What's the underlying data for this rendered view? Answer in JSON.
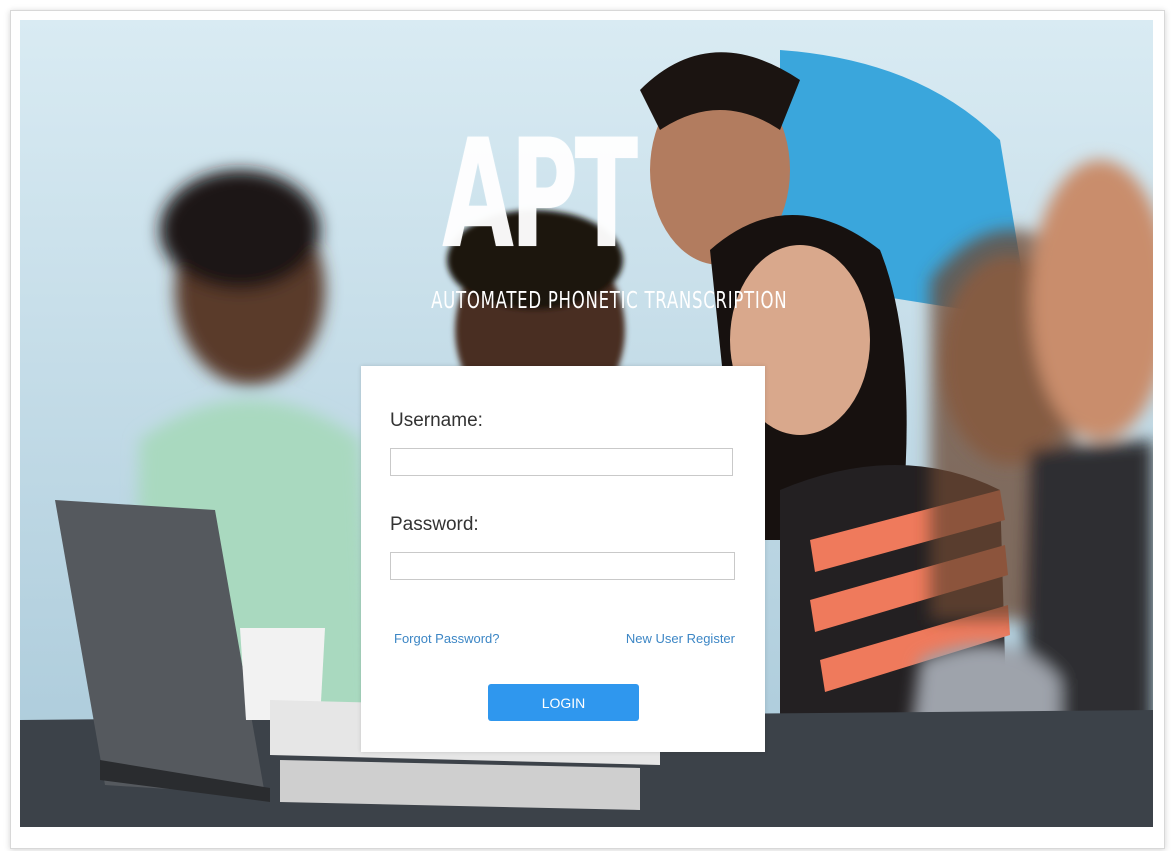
{
  "logo": {
    "title": "APT",
    "subtitle": "AUTOMATED PHONETIC TRANSCRIPTION"
  },
  "login": {
    "username_label": "Username:",
    "username_value": "",
    "password_label": "Password:",
    "password_value": "",
    "forgot_link": "Forgot Password?",
    "register_link": "New User Register",
    "login_button": "LOGIN"
  },
  "colors": {
    "accent": "#2f97ee",
    "link": "#3c86c5",
    "card_background": "#ffffff"
  }
}
